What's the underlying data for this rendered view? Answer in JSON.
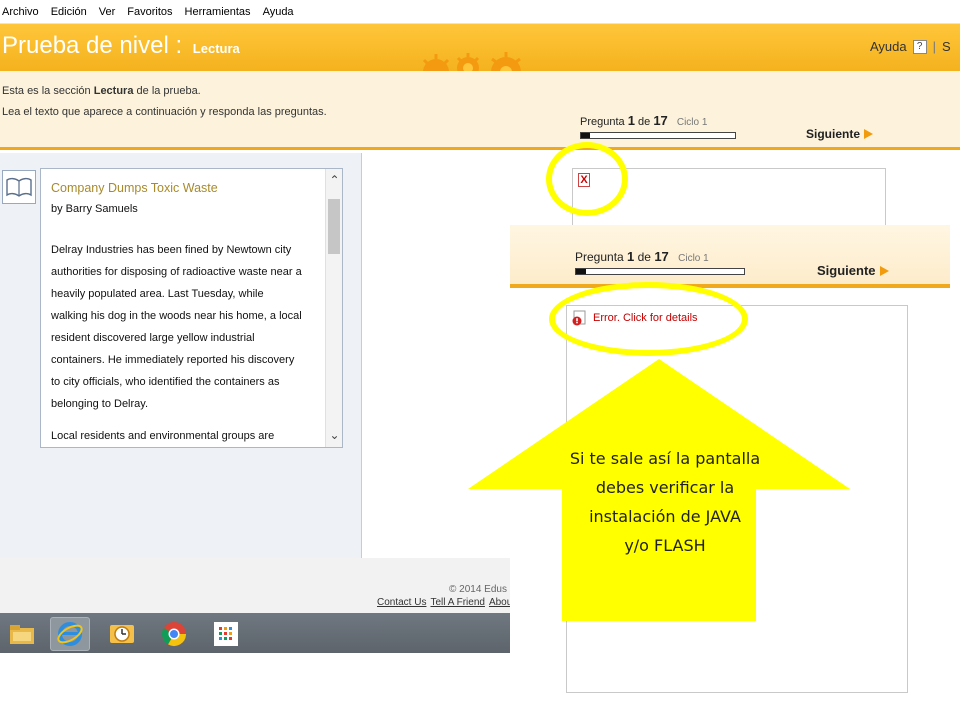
{
  "menu": [
    "Archivo",
    "Edición",
    "Ver",
    "Favoritos",
    "Herramientas",
    "Ayuda"
  ],
  "header": {
    "title": "Prueba de nivel :",
    "section": "Lectura",
    "help_label": "Ayuda",
    "help_box": "?",
    "separator": "|",
    "truncated": "S"
  },
  "instructions": {
    "line1_prefix": "Esta es la sección ",
    "line1_bold": "Lectura",
    "line1_suffix": " de la prueba.",
    "line2": "Lea el texto que aparece a continuación y responda las preguntas."
  },
  "progress": {
    "label": "Pregunta",
    "current": "1",
    "of_label": "de",
    "total": "17",
    "cycle_label": "Ciclo 1",
    "next_label": "Siguiente",
    "progress_fraction": 0.06
  },
  "article": {
    "title": "Company Dumps Toxic Waste",
    "author": "by Barry Samuels",
    "lines": [
      "Delray Industries has been fined by Newtown city",
      "authorities for disposing of radioactive waste near a",
      "heavily populated area. Last Tuesday, while",
      "walking his dog in the woods near his home, a local",
      "resident discovered large yellow industrial",
      "containers. He immediately reported his discovery",
      "to city officials, who identified the containers as",
      "belonging to Delray."
    ],
    "para2": "Local residents and environmental groups are"
  },
  "question_area": {
    "broken_icon": "X",
    "error_text": "Error. Click for details"
  },
  "footer": {
    "copyright": "© 2014  Edus",
    "links": [
      "Contact Us",
      "Tell A Friend",
      "Abou"
    ]
  },
  "taskbar_icons": [
    "file-explorer-icon",
    "internet-explorer-icon",
    "outlook-icon",
    "chrome-icon",
    "apps-grid-icon"
  ],
  "callout": {
    "line1": "Si te sale así la pantalla",
    "line2": "debes verificar la",
    "line3": "instalación de JAVA",
    "line4": "y/o FLASH"
  },
  "colors": {
    "header_orange": "#f4b21e",
    "accent_line": "#f0a81c",
    "next_arrow": "#f29b0c",
    "highlight_yellow": "#ffff00",
    "error_red": "#c40000",
    "article_title": "#a88a2c"
  }
}
